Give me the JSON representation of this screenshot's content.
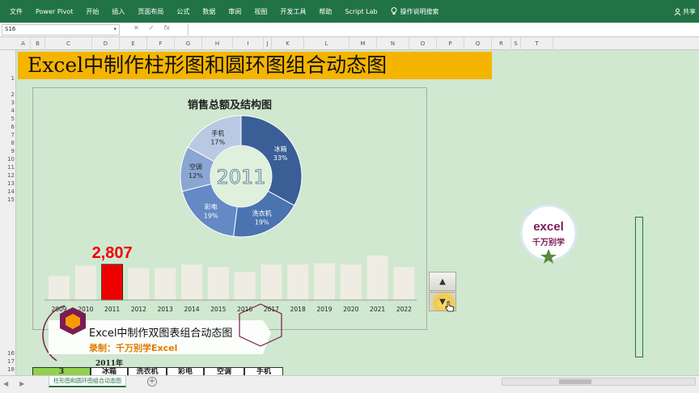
{
  "ribbon": {
    "tabs": [
      "文件",
      "Power Pivot",
      "开始",
      "插入",
      "页面布局",
      "公式",
      "数据",
      "审阅",
      "视图",
      "开发工具",
      "帮助",
      "Script Lab"
    ],
    "tell_me": "操作说明搜索",
    "share": "共享"
  },
  "formula_bar": {
    "name_box": "S16",
    "cancel_symbol": "✕",
    "enter_symbol": "✓",
    "fx": "fx",
    "formula": ""
  },
  "columns": [
    "A",
    "B",
    "C",
    "D",
    "E",
    "F",
    "G",
    "H",
    "I",
    "J",
    "K",
    "L",
    "M",
    "N",
    "O",
    "P",
    "Q",
    "R",
    "S",
    "T"
  ],
  "rows": [
    "1",
    "2",
    "3",
    "4",
    "5",
    "6",
    "7",
    "8",
    "9",
    "10",
    "11",
    "12",
    "13",
    "14",
    "15",
    "16",
    "17",
    "18"
  ],
  "sheet_title": "Excel中制作柱形图和圆环图组合动态图",
  "chart_data": [
    {
      "type": "pie",
      "title": "销售总额及结构图",
      "center_label": "2011",
      "categories": [
        "冰箱",
        "洗衣机",
        "彩电",
        "空调",
        "手机"
      ],
      "values": [
        33,
        19,
        19,
        12,
        17
      ],
      "labels": [
        "33%",
        "19%",
        "19%",
        "12%",
        "17%"
      ],
      "colors": [
        "#3a5e96",
        "#4a73b0",
        "#6489c4",
        "#8aa6d2",
        "#b9c9e4"
      ]
    },
    {
      "type": "bar",
      "categories": [
        "2009",
        "2010",
        "2011",
        "2012",
        "2013",
        "2014",
        "2015",
        "2016",
        "2017",
        "2018",
        "2019",
        "2020",
        "2021",
        "2022"
      ],
      "values": [
        1900,
        2700,
        2807,
        2500,
        2500,
        2800,
        2600,
        2200,
        2800,
        2800,
        2900,
        2800,
        3500,
        2600
      ],
      "highlight_index": 2,
      "highlight_label": "2,807",
      "bar_color": "#efede3",
      "highlight_color": "#ee0000"
    }
  ],
  "spinner": {
    "up_symbol": "▲",
    "down_symbol": "▼"
  },
  "watermark": {
    "title": "Excel中制作双图表组合动态图",
    "subtitle": "录制：千万别学Excel"
  },
  "badge": {
    "line1": "excel",
    "line2": "千万别学"
  },
  "table": {
    "year_label": "2011年",
    "index_value": "3",
    "headers": [
      "冰箱",
      "洗衣机",
      "彩电",
      "空调",
      "手机"
    ]
  },
  "sheet_tab": "柱形图和圆环图组合动态图",
  "add_sheet": "+",
  "sheet_nav": {
    "prev": "◀",
    "next": "▶"
  }
}
